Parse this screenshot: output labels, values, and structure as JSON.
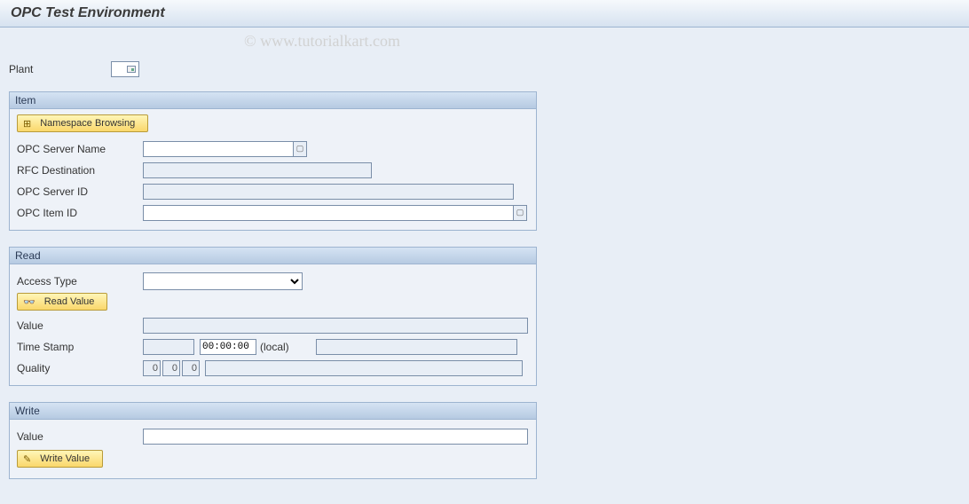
{
  "title": "OPC Test Environment",
  "watermark": "© www.tutorialkart.com",
  "plant": {
    "label": "Plant",
    "value": ""
  },
  "item": {
    "header": "Item",
    "namespace_btn": "Namespace Browsing",
    "opc_server_name": {
      "label": "OPC Server Name",
      "value": ""
    },
    "rfc_destination": {
      "label": "RFC Destination",
      "value": ""
    },
    "opc_server_id": {
      "label": "OPC Server ID",
      "value": ""
    },
    "opc_item_id": {
      "label": "OPC Item ID",
      "value": ""
    }
  },
  "read": {
    "header": "Read",
    "access_type": {
      "label": "Access Type",
      "value": ""
    },
    "read_value_btn": "Read Value",
    "value": {
      "label": "Value",
      "value": ""
    },
    "time_stamp": {
      "label": "Time Stamp",
      "date": "",
      "time": "00:00:00",
      "suffix": "(local)",
      "extra": ""
    },
    "quality": {
      "label": "Quality",
      "v1": "0",
      "v2": "0",
      "v3": "0",
      "text": ""
    }
  },
  "write": {
    "header": "Write",
    "value": {
      "label": "Value",
      "value": ""
    },
    "write_value_btn": "Write Value"
  }
}
